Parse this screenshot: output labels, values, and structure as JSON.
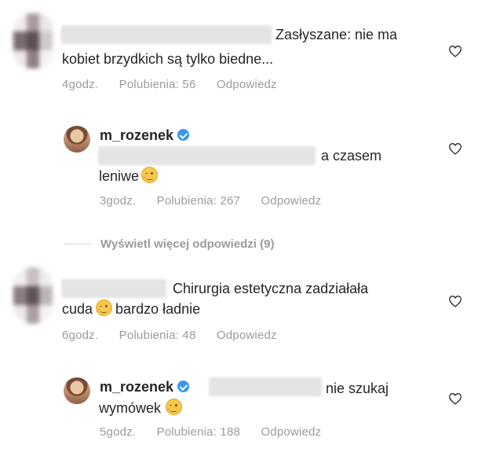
{
  "comments": [
    {
      "text_line1": "Zasłyszane: nie ma",
      "text_line2": "kobiet brzydkich są tylko biedne...",
      "time": "4godz.",
      "likes": "Polubienia: 56",
      "reply": "Odpowiedz"
    },
    {
      "username": "m_rozenek",
      "text_line1": "a czasem",
      "text_line2": "leniwe",
      "time": "3godz.",
      "likes": "Polubienia: 267",
      "reply": "Odpowiedz"
    },
    {
      "text_line1": "Chirurgia estetyczna zadziałała",
      "text_line2a": "cuda",
      "text_line2b": "bardzo ładnie",
      "time": "6godz.",
      "likes": "Polubienia: 48",
      "reply": "Odpowiedz"
    },
    {
      "username": "m_rozenek",
      "text_line1": "nie szukaj",
      "text_line2": "wymówek",
      "time": "5godz.",
      "likes": "Polubienia: 188",
      "reply": "Odpowiedz"
    }
  ],
  "view_more_replies": "Wyświetl więcej odpowiedzi (9)",
  "icons": {
    "like": "heart-outline-icon",
    "verified": "verified-badge-icon",
    "emoji": "winking-face-emoji"
  },
  "colors": {
    "text": "#262626",
    "meta": "#9b9b9b",
    "verified": "#3897f0"
  }
}
